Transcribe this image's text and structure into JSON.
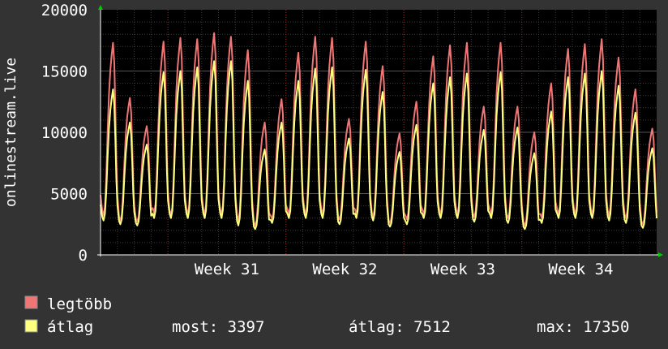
{
  "chart_data": {
    "type": "line",
    "ylabel": "onlinestream.live",
    "ylim": [
      0,
      20000
    ],
    "y_ticks": [
      "0",
      "5000",
      "10000",
      "15000",
      "20000"
    ],
    "x_ticks": [
      "Week 31",
      "Week 32",
      "Week 33",
      "Week 34"
    ],
    "days": 33,
    "week_starts_day": 4,
    "grid": true,
    "legend_position": "bottom-left",
    "series": [
      {
        "name": "legtöbb",
        "color": "#f07575",
        "peaks": [
          17300,
          12800,
          10500,
          17400,
          17700,
          17600,
          18100,
          17800,
          16700,
          10800,
          12700,
          16500,
          17800,
          17700,
          11100,
          17400,
          15400,
          9900,
          12500,
          16200,
          17100,
          17300,
          12100,
          17300,
          12100,
          10000,
          14000,
          16800,
          17200,
          17600,
          16100,
          13500,
          10300
        ],
        "mins": [
          3200,
          2800,
          2700,
          3400,
          3200,
          3300,
          3300,
          3300,
          2800,
          2400,
          2900,
          3300,
          3300,
          3300,
          2900,
          3300,
          3100,
          2600,
          2900,
          3300,
          3300,
          3300,
          3100,
          3300,
          3000,
          2400,
          3000,
          3300,
          3300,
          3300,
          3200,
          3000,
          2500
        ]
      },
      {
        "name": "átlag",
        "color": "#ffff80",
        "peaks": [
          13500,
          10800,
          9000,
          14900,
          15000,
          15300,
          15800,
          15800,
          14200,
          8600,
          10800,
          14200,
          15200,
          15300,
          9500,
          15100,
          13300,
          8400,
          10600,
          14000,
          14500,
          14800,
          10200,
          14900,
          10400,
          8300,
          11700,
          14500,
          14800,
          15000,
          13800,
          11600,
          8700
        ],
        "mins": [
          2800,
          2500,
          2400,
          3000,
          3000,
          3000,
          3000,
          3000,
          2400,
          2100,
          2600,
          3000,
          3000,
          3000,
          2500,
          3000,
          2800,
          2300,
          2500,
          3000,
          3000,
          3000,
          2700,
          3000,
          2600,
          2100,
          2600,
          3000,
          3000,
          3000,
          2800,
          2600,
          2200
        ]
      }
    ]
  },
  "legend": {
    "max_label": "legtöbb",
    "avg_label": "átlag",
    "max_color": "#f07575",
    "avg_color": "#ffff80"
  },
  "stats": {
    "now": "most: 3397",
    "avg": "átlag: 7512",
    "max": "max: 17350"
  }
}
